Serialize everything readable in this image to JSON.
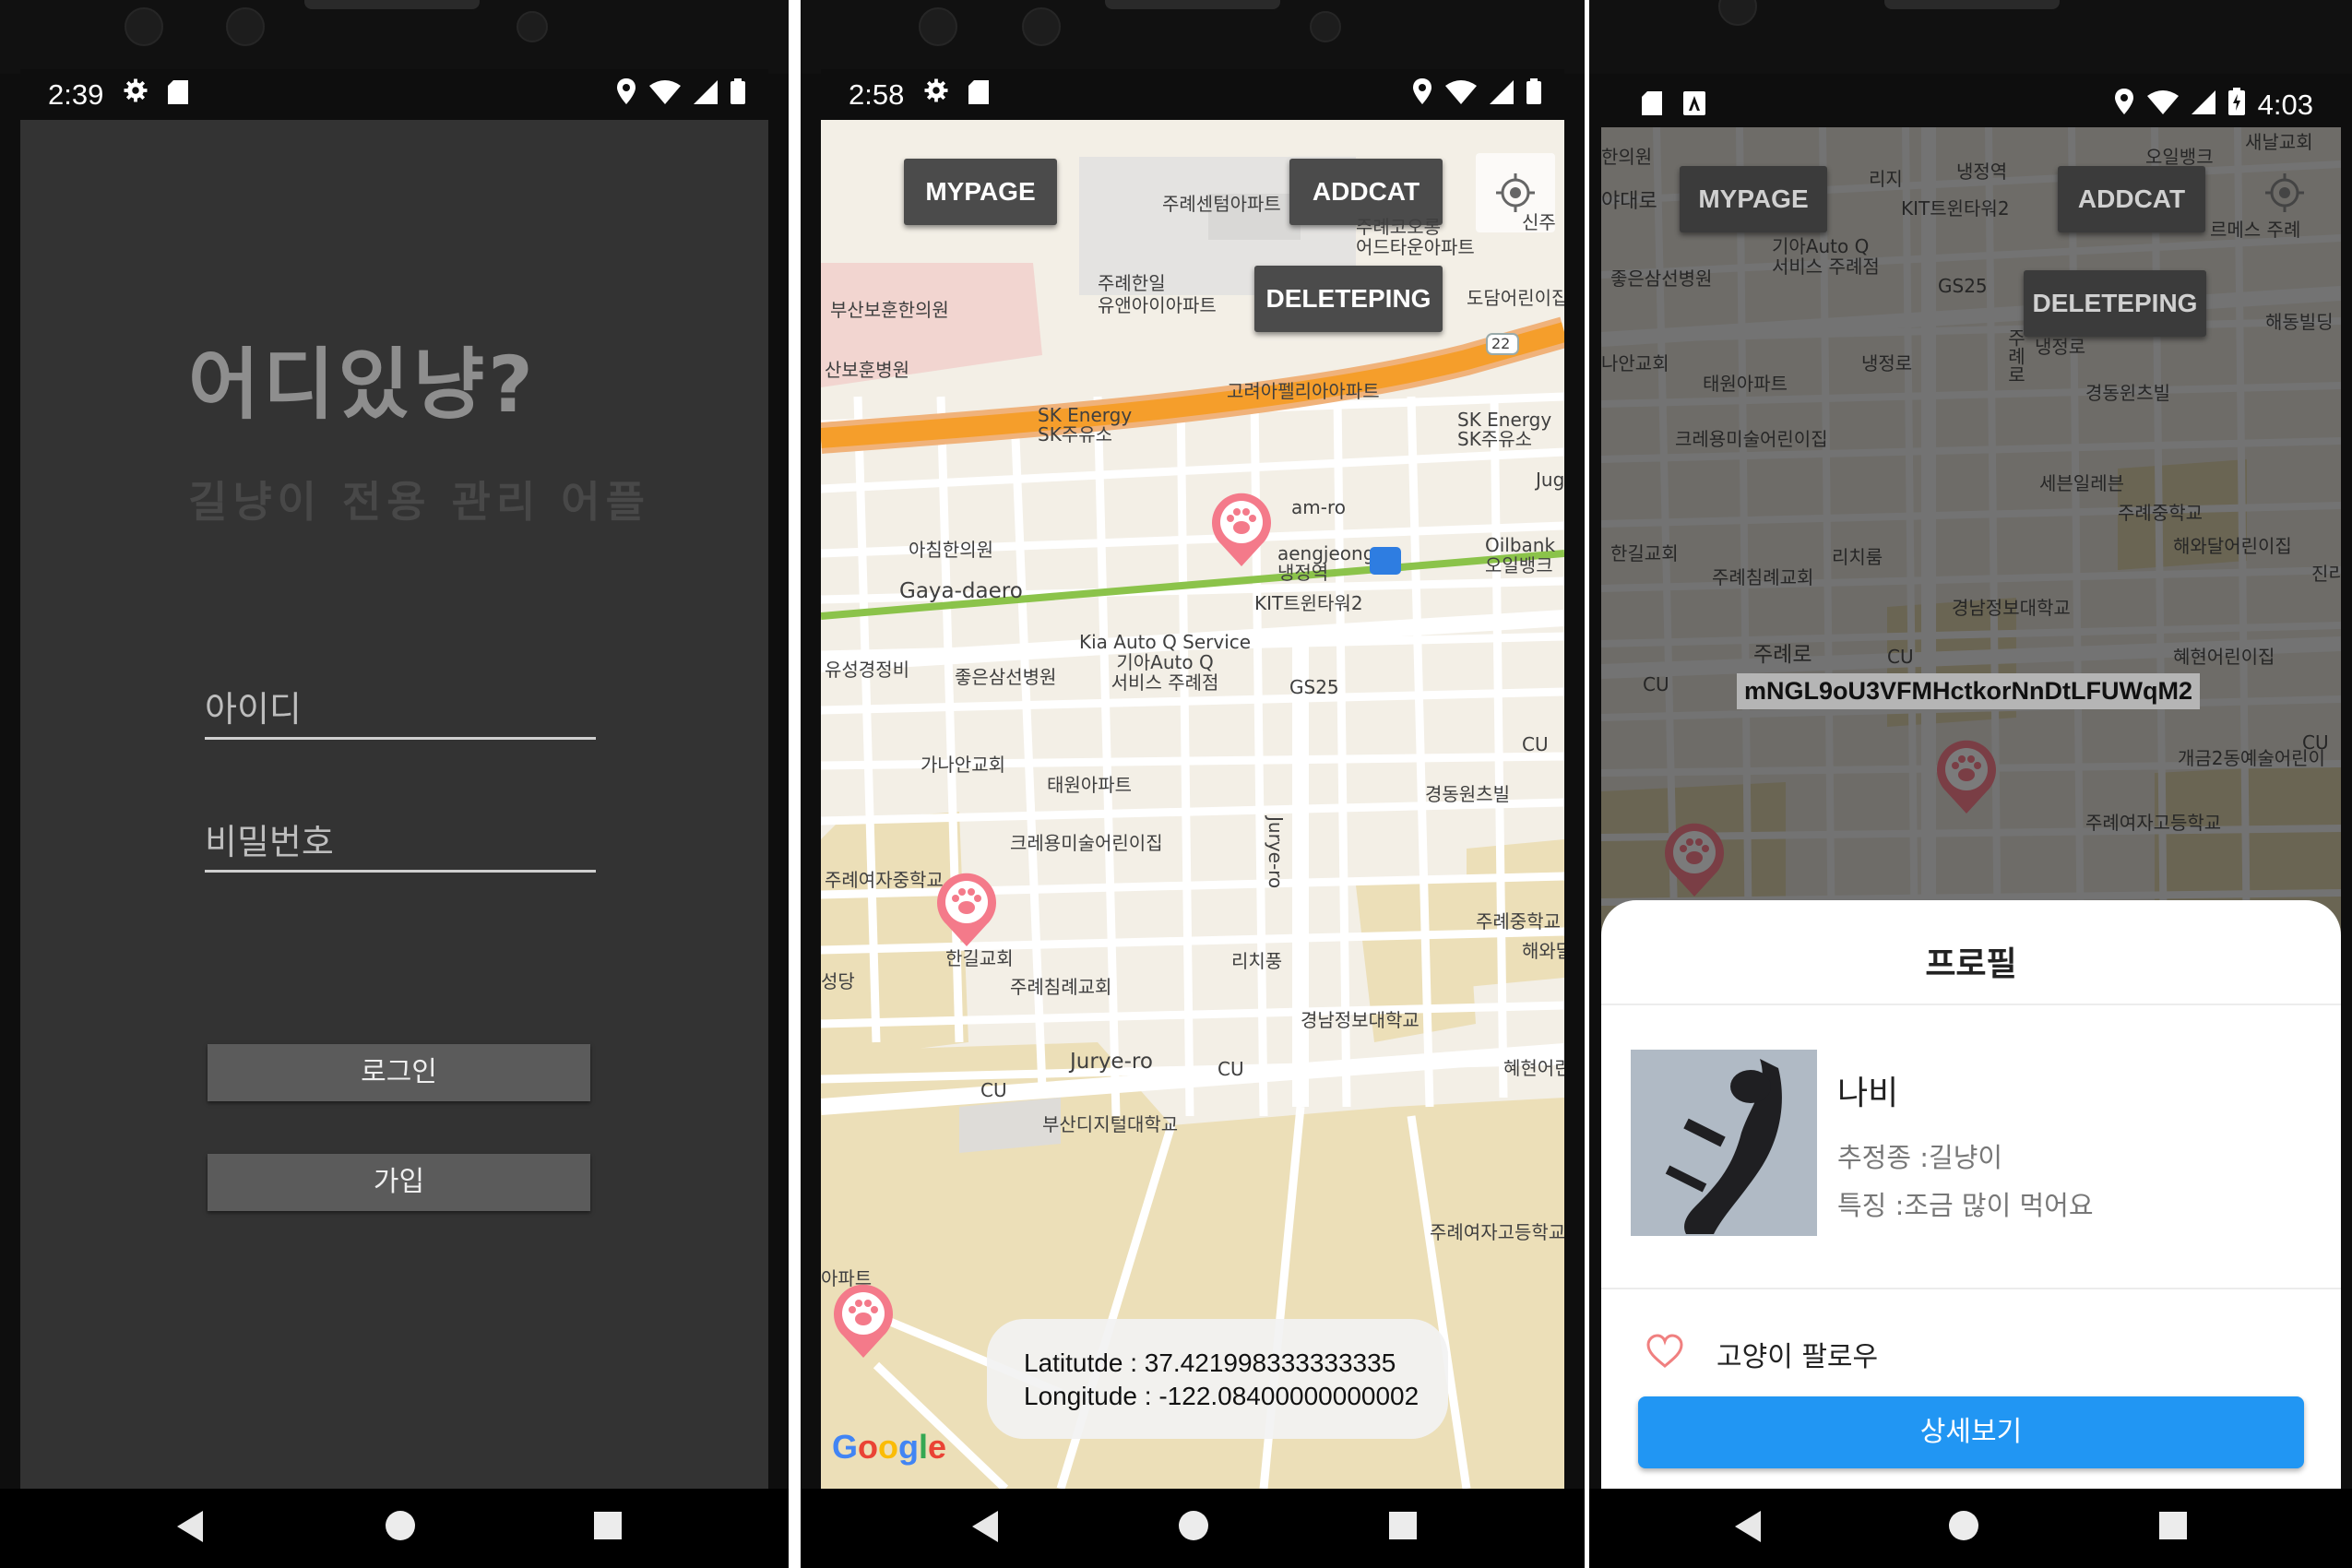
{
  "phone1": {
    "status_time": "2:39",
    "logo_title": "어디있냥?",
    "logo_subtitle": "길냥이 전용 관리 어플",
    "id_placeholder": "아이디",
    "password_placeholder": "비밀번호",
    "login_label": "로그인",
    "signup_label": "가입"
  },
  "phone2": {
    "status_time": "2:58",
    "buttons": {
      "mypage": "MYPAGE",
      "addcat": "ADDCAT",
      "deleteping": "DELETEPING"
    },
    "labels": {
      "l1": "주례센텀아파트",
      "l2": "주례한일\n유앤아이아파트",
      "l3": "주례코오롱\n어드타운아파트",
      "l4": "도담어린이집",
      "l5": "신주",
      "l6": "부산보훈한의원",
      "l7": "산보훈병원",
      "l8": "고려아펠리아아파트",
      "l9": "SK Energy\nSK주유소",
      "l10": "SK Energy\nSK주유소",
      "l11": "am-ro",
      "l12": "아침한의원",
      "l13": "Gaya-daero",
      "l14": "aengjeong\n냉정역",
      "l15": "Oilbank\n오일뱅크",
      "l16": "KIT트윈타워2",
      "l17": "Kia Auto Q Service\n기아Auto Q\n서비스 주례점",
      "l18": "유성경정비",
      "l19": "좋은삼선병원",
      "l20": "GS25",
      "l21": "가나안교회",
      "l22": "태원아파트",
      "l23": "경동원츠빌",
      "l24": "CU",
      "l25": "크레용미술어린이집",
      "l26": "Jurye-ro",
      "l27": "주례여자중학교",
      "l28": "한길교회",
      "l29": "리치풍",
      "l30": "주례중학교",
      "l31": "해와달",
      "l32": "주례침례교회",
      "l33": "경남정보대학교",
      "l34": "Jurye-ro",
      "l35": "CU",
      "l36": "혜현어린",
      "l37": "CU",
      "l38": "부산디지털대학교",
      "l39": "성당",
      "l40": "주례여자고등학교",
      "l41": "아파트",
      "l42": "Jug",
      "l43": "22"
    },
    "latitude": "Latitutde : 37.421998333333335",
    "longitude": "Longitude : -122.08400000000002",
    "google": "Google"
  },
  "phone3": {
    "status_time": "4:03",
    "buttons": {
      "mypage": "MYPAGE",
      "addcat": "ADDCAT",
      "deleteping": "DELETEPING"
    },
    "labels": {
      "m1": "한의원",
      "m2": "야대로",
      "m3": "리지",
      "m4": "냉정역",
      "m5": "오일뱅크",
      "m6": "새날교회",
      "m7": "KIT트윈타워2",
      "m8": "좋은삼선병원",
      "m9": "기아Auto Q\n서비스 주례점",
      "m10": "GS25",
      "m11": "르메스 주례",
      "m12": "해동빌딩",
      "m13": "냉정로",
      "m14": "나안교회",
      "m15": "태원아파트",
      "m16": "경동윈츠빌",
      "m17": "크레용미술어린이집",
      "m18": "세븐일레븐",
      "m19": "주례중학교",
      "m20": "해와달어린이집",
      "m21": "한길교회",
      "m22": "리치룸",
      "m23": "진리",
      "m24": "주례침례교회",
      "m25": "경남정보대학교",
      "m26": "주례로",
      "m27": "CU",
      "m28": "혜현어린이집",
      "m29": "CU",
      "m30": "개금2동예술어린이",
      "m31": "주례여자고등학교",
      "m32": "CU",
      "m33": "주례로",
      "m34": "냉정로"
    },
    "marker_label": "mNGL9oU3VFMHctkorNnDtLFUWqM2",
    "profile": {
      "title": "프로필",
      "name": "나비",
      "species": "추정종 :길냥이",
      "feature": "특징 :조금 많이 먹어요",
      "follow": "고양이 팔로우",
      "detail": "상세보기"
    }
  },
  "colors": {
    "accent_blue": "#2196f3",
    "paw_pink": "#f47a8a",
    "road_orange": "#f59e2b",
    "rail_green": "#8bc34a"
  }
}
